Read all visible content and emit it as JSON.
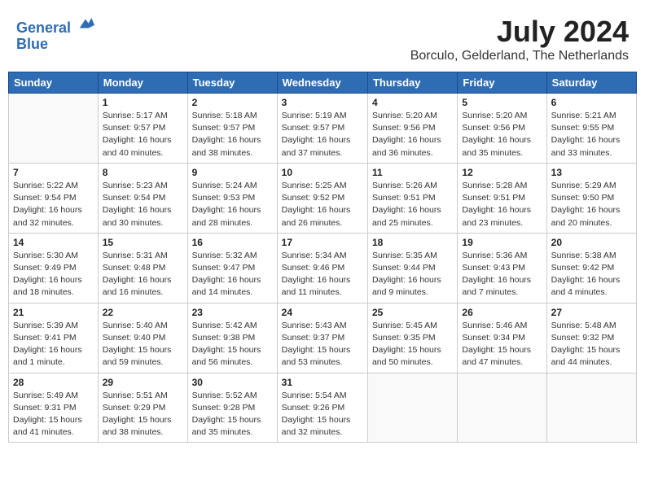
{
  "header": {
    "logo_line1": "General",
    "logo_line2": "Blue",
    "month_year": "July 2024",
    "location": "Borculo, Gelderland, The Netherlands"
  },
  "days_of_week": [
    "Sunday",
    "Monday",
    "Tuesday",
    "Wednesday",
    "Thursday",
    "Friday",
    "Saturday"
  ],
  "weeks": [
    [
      {
        "day": "",
        "info": ""
      },
      {
        "day": "1",
        "info": "Sunrise: 5:17 AM\nSunset: 9:57 PM\nDaylight: 16 hours\nand 40 minutes."
      },
      {
        "day": "2",
        "info": "Sunrise: 5:18 AM\nSunset: 9:57 PM\nDaylight: 16 hours\nand 38 minutes."
      },
      {
        "day": "3",
        "info": "Sunrise: 5:19 AM\nSunset: 9:57 PM\nDaylight: 16 hours\nand 37 minutes."
      },
      {
        "day": "4",
        "info": "Sunrise: 5:20 AM\nSunset: 9:56 PM\nDaylight: 16 hours\nand 36 minutes."
      },
      {
        "day": "5",
        "info": "Sunrise: 5:20 AM\nSunset: 9:56 PM\nDaylight: 16 hours\nand 35 minutes."
      },
      {
        "day": "6",
        "info": "Sunrise: 5:21 AM\nSunset: 9:55 PM\nDaylight: 16 hours\nand 33 minutes."
      }
    ],
    [
      {
        "day": "7",
        "info": "Sunrise: 5:22 AM\nSunset: 9:54 PM\nDaylight: 16 hours\nand 32 minutes."
      },
      {
        "day": "8",
        "info": "Sunrise: 5:23 AM\nSunset: 9:54 PM\nDaylight: 16 hours\nand 30 minutes."
      },
      {
        "day": "9",
        "info": "Sunrise: 5:24 AM\nSunset: 9:53 PM\nDaylight: 16 hours\nand 28 minutes."
      },
      {
        "day": "10",
        "info": "Sunrise: 5:25 AM\nSunset: 9:52 PM\nDaylight: 16 hours\nand 26 minutes."
      },
      {
        "day": "11",
        "info": "Sunrise: 5:26 AM\nSunset: 9:51 PM\nDaylight: 16 hours\nand 25 minutes."
      },
      {
        "day": "12",
        "info": "Sunrise: 5:28 AM\nSunset: 9:51 PM\nDaylight: 16 hours\nand 23 minutes."
      },
      {
        "day": "13",
        "info": "Sunrise: 5:29 AM\nSunset: 9:50 PM\nDaylight: 16 hours\nand 20 minutes."
      }
    ],
    [
      {
        "day": "14",
        "info": "Sunrise: 5:30 AM\nSunset: 9:49 PM\nDaylight: 16 hours\nand 18 minutes."
      },
      {
        "day": "15",
        "info": "Sunrise: 5:31 AM\nSunset: 9:48 PM\nDaylight: 16 hours\nand 16 minutes."
      },
      {
        "day": "16",
        "info": "Sunrise: 5:32 AM\nSunset: 9:47 PM\nDaylight: 16 hours\nand 14 minutes."
      },
      {
        "day": "17",
        "info": "Sunrise: 5:34 AM\nSunset: 9:46 PM\nDaylight: 16 hours\nand 11 minutes."
      },
      {
        "day": "18",
        "info": "Sunrise: 5:35 AM\nSunset: 9:44 PM\nDaylight: 16 hours\nand 9 minutes."
      },
      {
        "day": "19",
        "info": "Sunrise: 5:36 AM\nSunset: 9:43 PM\nDaylight: 16 hours\nand 7 minutes."
      },
      {
        "day": "20",
        "info": "Sunrise: 5:38 AM\nSunset: 9:42 PM\nDaylight: 16 hours\nand 4 minutes."
      }
    ],
    [
      {
        "day": "21",
        "info": "Sunrise: 5:39 AM\nSunset: 9:41 PM\nDaylight: 16 hours\nand 1 minute."
      },
      {
        "day": "22",
        "info": "Sunrise: 5:40 AM\nSunset: 9:40 PM\nDaylight: 15 hours\nand 59 minutes."
      },
      {
        "day": "23",
        "info": "Sunrise: 5:42 AM\nSunset: 9:38 PM\nDaylight: 15 hours\nand 56 minutes."
      },
      {
        "day": "24",
        "info": "Sunrise: 5:43 AM\nSunset: 9:37 PM\nDaylight: 15 hours\nand 53 minutes."
      },
      {
        "day": "25",
        "info": "Sunrise: 5:45 AM\nSunset: 9:35 PM\nDaylight: 15 hours\nand 50 minutes."
      },
      {
        "day": "26",
        "info": "Sunrise: 5:46 AM\nSunset: 9:34 PM\nDaylight: 15 hours\nand 47 minutes."
      },
      {
        "day": "27",
        "info": "Sunrise: 5:48 AM\nSunset: 9:32 PM\nDaylight: 15 hours\nand 44 minutes."
      }
    ],
    [
      {
        "day": "28",
        "info": "Sunrise: 5:49 AM\nSunset: 9:31 PM\nDaylight: 15 hours\nand 41 minutes."
      },
      {
        "day": "29",
        "info": "Sunrise: 5:51 AM\nSunset: 9:29 PM\nDaylight: 15 hours\nand 38 minutes."
      },
      {
        "day": "30",
        "info": "Sunrise: 5:52 AM\nSunset: 9:28 PM\nDaylight: 15 hours\nand 35 minutes."
      },
      {
        "day": "31",
        "info": "Sunrise: 5:54 AM\nSunset: 9:26 PM\nDaylight: 15 hours\nand 32 minutes."
      },
      {
        "day": "",
        "info": ""
      },
      {
        "day": "",
        "info": ""
      },
      {
        "day": "",
        "info": ""
      }
    ]
  ]
}
